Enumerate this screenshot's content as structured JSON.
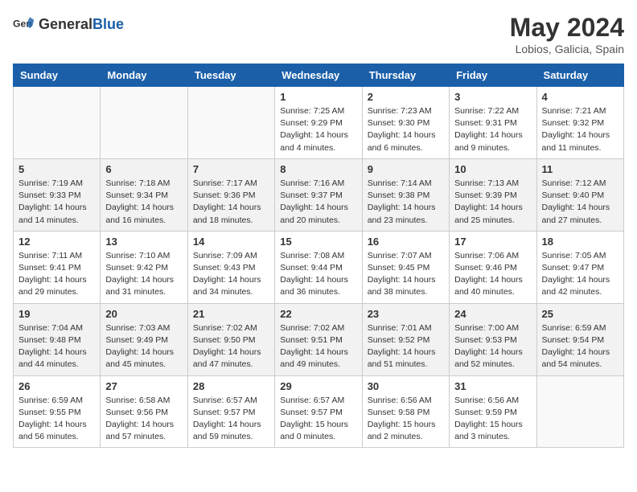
{
  "header": {
    "logo_general": "General",
    "logo_blue": "Blue",
    "title": "May 2024",
    "location": "Lobios, Galicia, Spain"
  },
  "days_of_week": [
    "Sunday",
    "Monday",
    "Tuesday",
    "Wednesday",
    "Thursday",
    "Friday",
    "Saturday"
  ],
  "weeks": [
    {
      "alt": false,
      "days": [
        {
          "num": "",
          "info": ""
        },
        {
          "num": "",
          "info": ""
        },
        {
          "num": "",
          "info": ""
        },
        {
          "num": "1",
          "info": "Sunrise: 7:25 AM\nSunset: 9:29 PM\nDaylight: 14 hours\nand 4 minutes."
        },
        {
          "num": "2",
          "info": "Sunrise: 7:23 AM\nSunset: 9:30 PM\nDaylight: 14 hours\nand 6 minutes."
        },
        {
          "num": "3",
          "info": "Sunrise: 7:22 AM\nSunset: 9:31 PM\nDaylight: 14 hours\nand 9 minutes."
        },
        {
          "num": "4",
          "info": "Sunrise: 7:21 AM\nSunset: 9:32 PM\nDaylight: 14 hours\nand 11 minutes."
        }
      ]
    },
    {
      "alt": true,
      "days": [
        {
          "num": "5",
          "info": "Sunrise: 7:19 AM\nSunset: 9:33 PM\nDaylight: 14 hours\nand 14 minutes."
        },
        {
          "num": "6",
          "info": "Sunrise: 7:18 AM\nSunset: 9:34 PM\nDaylight: 14 hours\nand 16 minutes."
        },
        {
          "num": "7",
          "info": "Sunrise: 7:17 AM\nSunset: 9:36 PM\nDaylight: 14 hours\nand 18 minutes."
        },
        {
          "num": "8",
          "info": "Sunrise: 7:16 AM\nSunset: 9:37 PM\nDaylight: 14 hours\nand 20 minutes."
        },
        {
          "num": "9",
          "info": "Sunrise: 7:14 AM\nSunset: 9:38 PM\nDaylight: 14 hours\nand 23 minutes."
        },
        {
          "num": "10",
          "info": "Sunrise: 7:13 AM\nSunset: 9:39 PM\nDaylight: 14 hours\nand 25 minutes."
        },
        {
          "num": "11",
          "info": "Sunrise: 7:12 AM\nSunset: 9:40 PM\nDaylight: 14 hours\nand 27 minutes."
        }
      ]
    },
    {
      "alt": false,
      "days": [
        {
          "num": "12",
          "info": "Sunrise: 7:11 AM\nSunset: 9:41 PM\nDaylight: 14 hours\nand 29 minutes."
        },
        {
          "num": "13",
          "info": "Sunrise: 7:10 AM\nSunset: 9:42 PM\nDaylight: 14 hours\nand 31 minutes."
        },
        {
          "num": "14",
          "info": "Sunrise: 7:09 AM\nSunset: 9:43 PM\nDaylight: 14 hours\nand 34 minutes."
        },
        {
          "num": "15",
          "info": "Sunrise: 7:08 AM\nSunset: 9:44 PM\nDaylight: 14 hours\nand 36 minutes."
        },
        {
          "num": "16",
          "info": "Sunrise: 7:07 AM\nSunset: 9:45 PM\nDaylight: 14 hours\nand 38 minutes."
        },
        {
          "num": "17",
          "info": "Sunrise: 7:06 AM\nSunset: 9:46 PM\nDaylight: 14 hours\nand 40 minutes."
        },
        {
          "num": "18",
          "info": "Sunrise: 7:05 AM\nSunset: 9:47 PM\nDaylight: 14 hours\nand 42 minutes."
        }
      ]
    },
    {
      "alt": true,
      "days": [
        {
          "num": "19",
          "info": "Sunrise: 7:04 AM\nSunset: 9:48 PM\nDaylight: 14 hours\nand 44 minutes."
        },
        {
          "num": "20",
          "info": "Sunrise: 7:03 AM\nSunset: 9:49 PM\nDaylight: 14 hours\nand 45 minutes."
        },
        {
          "num": "21",
          "info": "Sunrise: 7:02 AM\nSunset: 9:50 PM\nDaylight: 14 hours\nand 47 minutes."
        },
        {
          "num": "22",
          "info": "Sunrise: 7:02 AM\nSunset: 9:51 PM\nDaylight: 14 hours\nand 49 minutes."
        },
        {
          "num": "23",
          "info": "Sunrise: 7:01 AM\nSunset: 9:52 PM\nDaylight: 14 hours\nand 51 minutes."
        },
        {
          "num": "24",
          "info": "Sunrise: 7:00 AM\nSunset: 9:53 PM\nDaylight: 14 hours\nand 52 minutes."
        },
        {
          "num": "25",
          "info": "Sunrise: 6:59 AM\nSunset: 9:54 PM\nDaylight: 14 hours\nand 54 minutes."
        }
      ]
    },
    {
      "alt": false,
      "days": [
        {
          "num": "26",
          "info": "Sunrise: 6:59 AM\nSunset: 9:55 PM\nDaylight: 14 hours\nand 56 minutes."
        },
        {
          "num": "27",
          "info": "Sunrise: 6:58 AM\nSunset: 9:56 PM\nDaylight: 14 hours\nand 57 minutes."
        },
        {
          "num": "28",
          "info": "Sunrise: 6:57 AM\nSunset: 9:57 PM\nDaylight: 14 hours\nand 59 minutes."
        },
        {
          "num": "29",
          "info": "Sunrise: 6:57 AM\nSunset: 9:57 PM\nDaylight: 15 hours\nand 0 minutes."
        },
        {
          "num": "30",
          "info": "Sunrise: 6:56 AM\nSunset: 9:58 PM\nDaylight: 15 hours\nand 2 minutes."
        },
        {
          "num": "31",
          "info": "Sunrise: 6:56 AM\nSunset: 9:59 PM\nDaylight: 15 hours\nand 3 minutes."
        },
        {
          "num": "",
          "info": ""
        }
      ]
    }
  ]
}
